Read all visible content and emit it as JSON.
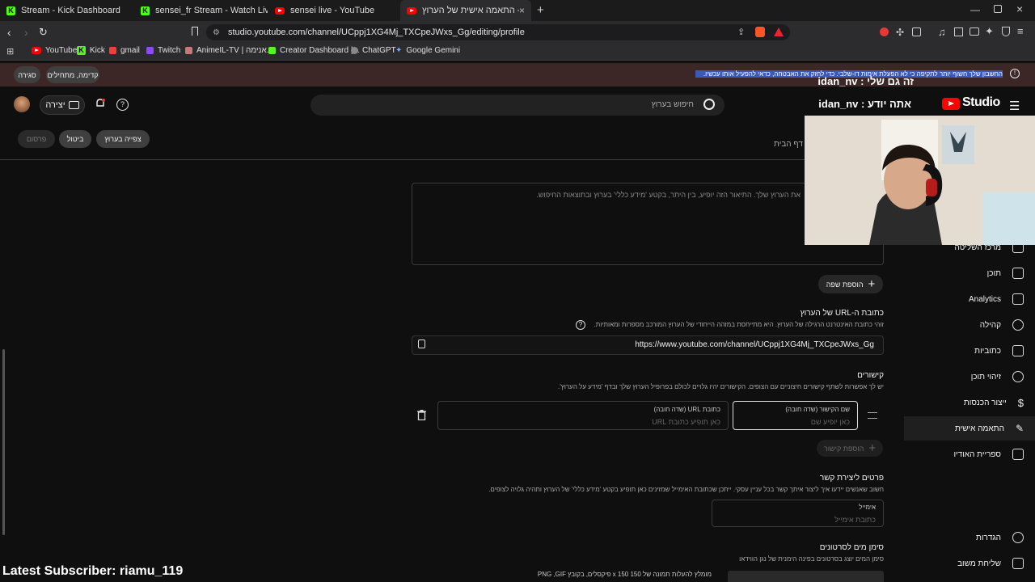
{
  "browser": {
    "tabs": [
      {
        "title": "Stream - Kick Dashboard",
        "icon": "kick-icon"
      },
      {
        "title": "sensei_fr Stream - Watch Live on Kick",
        "icon": "kick-icon"
      },
      {
        "title": "sensei live - YouTube",
        "icon": "youtube-icon"
      },
      {
        "title": "התאמה אישית של הערוץ - YouTube Studio",
        "icon": "youtube-icon"
      }
    ],
    "url": "studio.youtube.com/channel/UCppj1XG4Mj_TXCpeJWxs_Gg/editing/profile",
    "bookmarks": [
      "YouTube",
      "Kick",
      "gmail",
      "Twitch",
      "AnimeIL-TV | אנימה...",
      "Creator Dashboard |...",
      "ChatGPT",
      "Google Gemini"
    ]
  },
  "banner": {
    "text": "החשבון שלך חשוף יותר לתקיפה כי לא הפעלת אימות דו-שלבי. כדי לחזק את האבטחה, כדאי להפעיל אותו עכשיו.",
    "btn_continue": "קדימה, מתחילים",
    "btn_close": "סגירה"
  },
  "header": {
    "logo": "Studio",
    "search_placeholder": "חיפוש בערוץ",
    "create_label": "יצירה"
  },
  "overlay": {
    "line1": "זה גם שלי : idan_nv",
    "line2": "אתה יודע : idan_nv",
    "latest_subscriber": "Latest Subscriber: riamu_119"
  },
  "actions": {
    "publish": "פרסום",
    "cancel": "ביטול",
    "view_channel": "צפייה בערוץ",
    "home_tab": "דף הבית"
  },
  "sidebar": {
    "items": [
      {
        "label": "מרכז השליטה",
        "icon": "dashboard-icon"
      },
      {
        "label": "תוכן",
        "icon": "content-icon"
      },
      {
        "label": "Analytics",
        "icon": "analytics-icon"
      },
      {
        "label": "קהילה",
        "icon": "community-icon"
      },
      {
        "label": "כתוביות",
        "icon": "subtitles-icon"
      },
      {
        "label": "זיהוי תוכן",
        "icon": "copyright-icon"
      },
      {
        "label": "ייצור הכנסות",
        "icon": "monetization-icon"
      },
      {
        "label": "התאמה אישית",
        "icon": "customization-icon"
      },
      {
        "label": "ספריית האודיו",
        "icon": "audio-library-icon"
      }
    ],
    "settings": "הגדרות",
    "feedback": "שליחת משוב"
  },
  "form": {
    "description_placeholder": "את הערוץ שלך. התיאור הזה יופיע, בין היתר, בקטע 'מידע כללי' בערוץ ובתוצאות החיפוש.",
    "add_language": "הוספת שפה",
    "url_title": "כתובת ה-URL של הערוץ",
    "url_desc": "זוהי כתובת האינטרנט הרגילה של הערוץ. היא מתייחסת במזהה הייחודי של הערוץ המורכב מספרות ומאותיות.",
    "channel_url": "https://www.youtube.com/channel/UCppj1XG4Mj_TXCpeJWxs_Gg",
    "links_title": "קישורים",
    "links_desc": "יש לך אפשרות לשתף קישורים חיצוניים עם הצופים. הקישורים יהיו גלויים לכולם בפרופיל הערוץ שלך ובדף 'מידע על הערוץ'.",
    "link_name_label": "שם הקישור (שדה חובה)",
    "link_name_placeholder": "כאן יופיע שם",
    "link_url_label": "כתובת URL (שדה חובה)",
    "link_url_placeholder": "כאן תופיע כתובת URL",
    "add_link": "הוספת קישור",
    "contact_title": "פרטים ליצירת קשר",
    "contact_desc": "חשוב שאנשים יידעו איך ליצור איתך קשר בכל עניין עסקי. ייתכן שכתובת האימייל שמזינים כאן תופיע בקטע 'מידע כללי' של הערוץ ותהיה גלויה לצופים.",
    "email_label": "אימייל",
    "email_placeholder": "כתובת אימייל",
    "watermark_title": "סימן מים לסרטונים",
    "watermark_desc": "סימן המים יוצג בסרטונים בפינה הימנית של נגן הווידאו",
    "watermark_hint": "מומלץ להעלות תמונה של 150 x 150 פיקסלים, בקובץ PNG ,GIF"
  }
}
